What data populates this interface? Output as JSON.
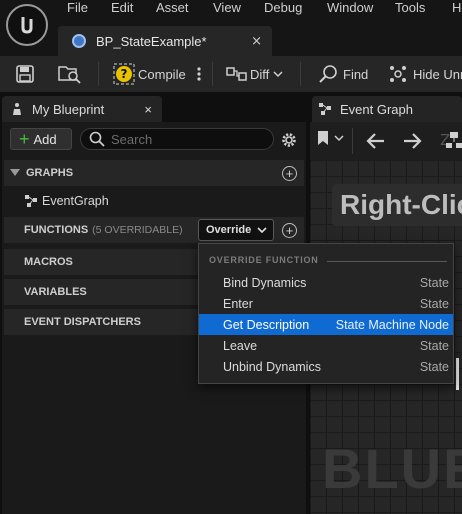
{
  "menubar": {
    "items": [
      "File",
      "Edit",
      "Asset",
      "View",
      "Debug",
      "Window",
      "Tools",
      "He"
    ]
  },
  "document_tab": {
    "title": "BP_StateExample*",
    "close": "×"
  },
  "toolbar": {
    "compile_label": "Compile",
    "diff_label": "Diff",
    "find_label": "Find",
    "hide_label": "Hide Unr"
  },
  "my_blueprint": {
    "tab_label": "My Blueprint",
    "close": "×",
    "add_label": "Add",
    "search_placeholder": "Search",
    "graphs_header": "GRAPHS",
    "event_graph": "EventGraph",
    "functions_header": "FUNCTIONS",
    "functions_count": "(5 OVERRIDABLE)",
    "override_label": "Override",
    "macros_header": "MACROS",
    "variables_header": "VARIABLES",
    "dispatchers_header": "EVENT DISPATCHERS"
  },
  "override_menu": {
    "header": "OVERRIDE FUNCTION",
    "items": [
      {
        "name": "Bind Dynamics",
        "context": "State"
      },
      {
        "name": "Enter",
        "context": "State"
      },
      {
        "name": "Get Description",
        "context": "State Machine Node",
        "selected": true
      },
      {
        "name": "Leave",
        "context": "State"
      },
      {
        "name": "Unbind Dynamics",
        "context": "State"
      }
    ]
  },
  "event_graph": {
    "tab_label": "Event Graph",
    "banner": "Right-Clic",
    "watermark": "BLUEI"
  },
  "colors": {
    "selection": "#0f6ad1",
    "compile_warning": "#e8c400",
    "add_green": "#4cbb3f"
  }
}
